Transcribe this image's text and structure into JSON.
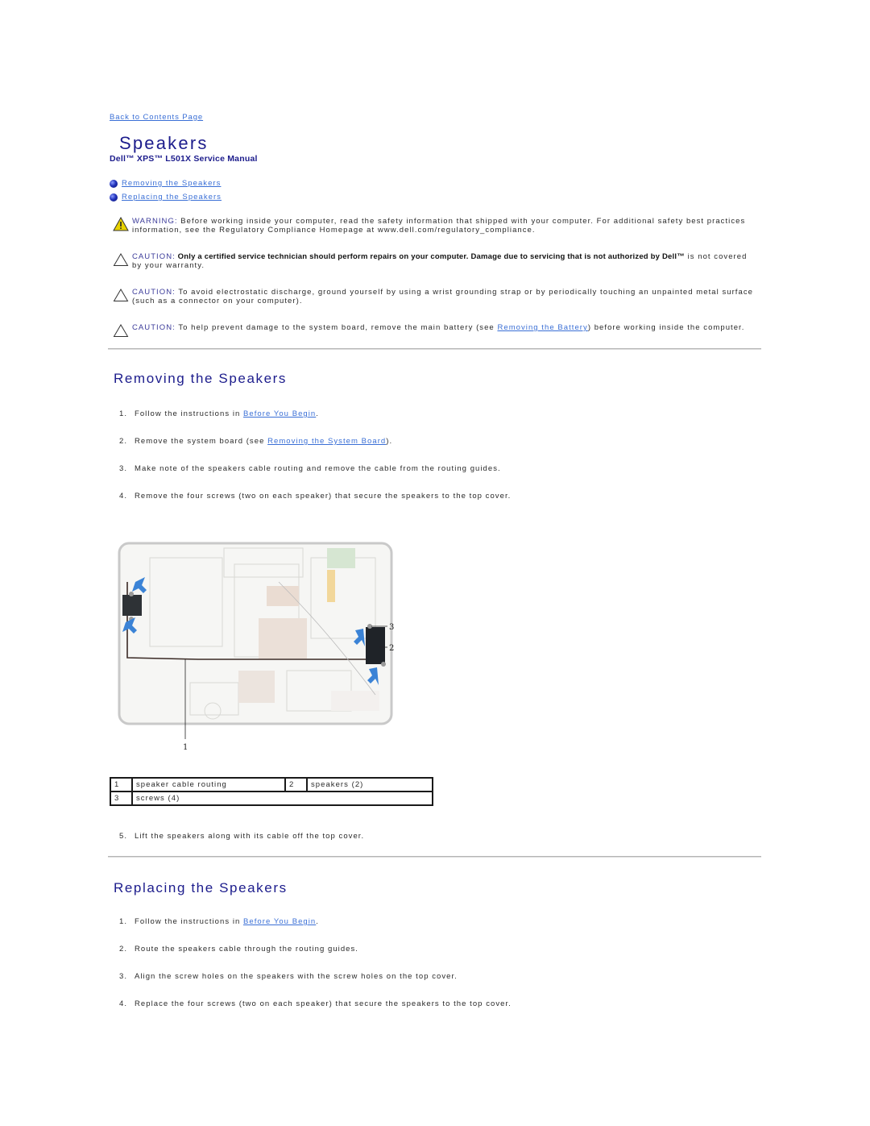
{
  "nav": {
    "back_link": "Back to Contents Page"
  },
  "header": {
    "title": "Speakers",
    "manual": "Dell™ XPS™ L501X Service Manual"
  },
  "toc": [
    {
      "label": "Removing the Speakers",
      "icon": "blue-bullet-icon"
    },
    {
      "label": "Replacing the Speakers",
      "icon": "blue-bullet-icon"
    }
  ],
  "notices": [
    {
      "type": "warning",
      "icon": "warning-triangle-icon",
      "label": "WARNING:",
      "text": " Before working inside your computer, read the safety information that shipped with your computer. For additional safety best practices information, see the Regulatory Compliance Homepage at www.dell.com/regulatory_compliance."
    },
    {
      "type": "caution",
      "icon": "caution-triangle-icon",
      "label": "CAUTION:",
      "bold": " Only a certified service technician should perform repairs on your computer. Damage due to servicing that is not authorized by Dell™",
      "text": " is not covered by your warranty."
    },
    {
      "type": "caution",
      "icon": "caution-triangle-icon",
      "label": "CAUTION:",
      "text": " To avoid electrostatic discharge, ground yourself by using a wrist grounding strap or by periodically touching an unpainted metal surface (such as a connector on your computer)."
    },
    {
      "type": "caution",
      "icon": "caution-triangle-icon",
      "label": "CAUTION:",
      "text_before": " To help prevent damage to the system board, remove the main battery (see ",
      "link": "Removing the Battery",
      "text_after": ") before working inside the computer."
    }
  ],
  "removing": {
    "heading": "Removing the Speakers",
    "steps": [
      {
        "num": "1.",
        "before": "Follow the instructions in ",
        "link": "Before You Begin",
        "after": "."
      },
      {
        "num": "2.",
        "before": "Remove the system board (see ",
        "link": "Removing the System Board",
        "after": ")."
      },
      {
        "num": "3.",
        "before": "Make note of the speakers cable routing and remove the cable from the routing guides."
      },
      {
        "num": "4.",
        "before": "Remove the four screws (two on each speaker) that secure the speakers to the top cover."
      }
    ],
    "figure_callouts": [
      "1",
      "2",
      "3"
    ],
    "legend": [
      [
        {
          "num": "1",
          "label": "speaker cable routing"
        },
        {
          "num": "2",
          "label": "speakers (2)"
        }
      ],
      [
        {
          "num": "3",
          "label": "screws (4)"
        }
      ]
    ],
    "step5": {
      "num": "5.",
      "before": "Lift the speakers along with its cable off the top cover."
    }
  },
  "replacing": {
    "heading": "Replacing the Speakers",
    "steps": [
      {
        "num": "1.",
        "before": "Follow the instructions in ",
        "link": "Before You Begin",
        "after": "."
      },
      {
        "num": "2.",
        "before": "Route the speakers cable through the routing guides."
      },
      {
        "num": "3.",
        "before": "Align the screw holes on the speakers with the screw holes on the top cover."
      },
      {
        "num": "4.",
        "before": "Replace the four screws (two on each speaker) that secure the speakers to the top cover."
      }
    ]
  },
  "colors": {
    "heading": "#1c1c8c",
    "link": "#3a6fd6",
    "warning_icon": "#e8d200"
  }
}
